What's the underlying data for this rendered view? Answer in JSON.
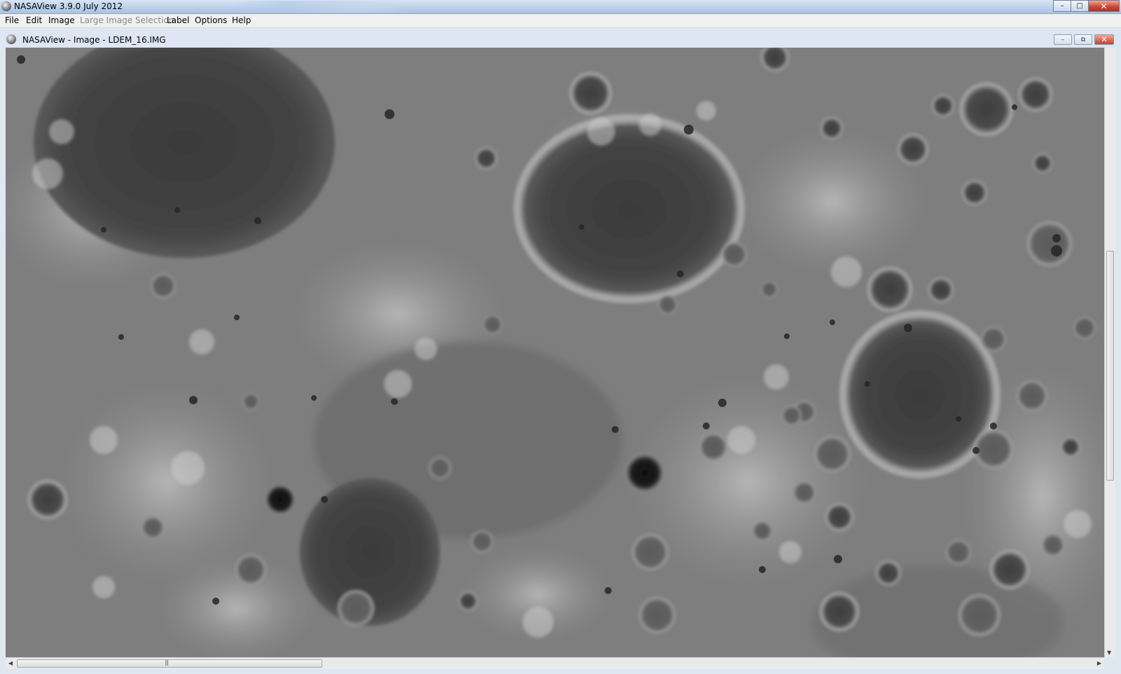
{
  "window": {
    "title": "NASAView 3.9.0 July 2012",
    "controls": {
      "minimize": "–",
      "maximize": "□",
      "close": "✕"
    }
  },
  "menu": {
    "items": [
      {
        "label": "File",
        "enabled": true
      },
      {
        "label": "Edit",
        "enabled": true
      },
      {
        "label": "Image",
        "enabled": true
      },
      {
        "label": "Large Image Selection",
        "enabled": false
      },
      {
        "label": "Label",
        "enabled": true
      },
      {
        "label": "Options",
        "enabled": true
      },
      {
        "label": "Help",
        "enabled": true
      }
    ]
  },
  "subwindow": {
    "title": "NASAView - Image - LDEM_16.IMG",
    "controls": {
      "minimize": "–",
      "restore": "⧉",
      "close": "✕"
    }
  },
  "image": {
    "description_icon": "lunar-elevation-map",
    "colors": {
      "base": "#7a7a7a",
      "dark": "#2a2a2a",
      "light": "#c9c9c9"
    }
  },
  "scrollbars": {
    "vertical": {
      "position": 0.33,
      "visible_fraction": 0.38
    },
    "horizontal": {
      "position": 0.0,
      "visible_fraction": 0.28
    }
  }
}
